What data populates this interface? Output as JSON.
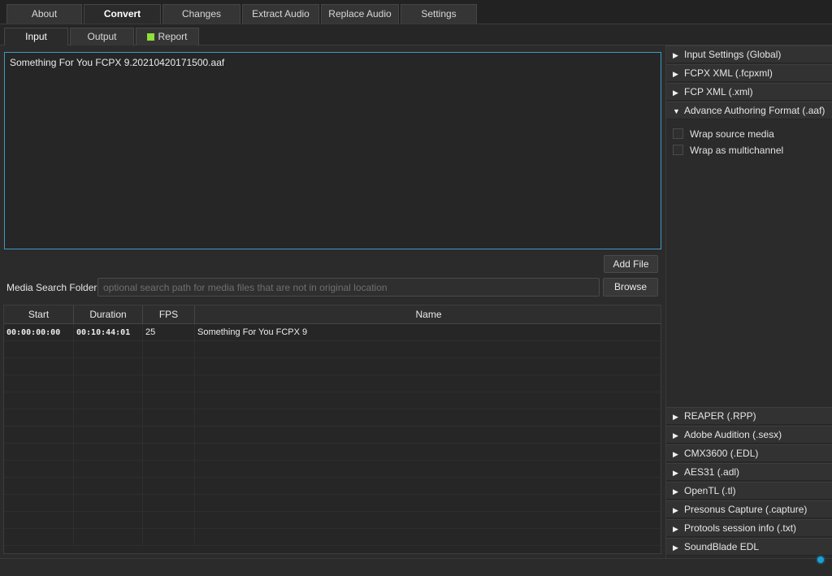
{
  "top_tabs": [
    "About",
    "Convert",
    "Changes",
    "Extract Audio",
    "Replace Audio",
    "Settings"
  ],
  "sub_tabs": [
    "Input",
    "Output",
    "Report"
  ],
  "input_files": [
    "Something For You FCPX 9.20210420171500.aaf"
  ],
  "add_file_label": "Add File",
  "media_search": {
    "label": "Media Search Folder",
    "placeholder": "optional search path for media files that are not in original location",
    "value": "",
    "browse_label": "Browse"
  },
  "table": {
    "headers": [
      "Start",
      "Duration",
      "FPS",
      "Name"
    ],
    "rows": [
      [
        "00:00:00:00",
        "00:10:44:01",
        "25",
        "Something For You FCPX 9"
      ]
    ]
  },
  "right_panel": {
    "sections_top": [
      {
        "label": "Input Settings (Global)",
        "arrow": "▶"
      },
      {
        "label": "FCPX XML (.fcpxml)",
        "arrow": "▶"
      },
      {
        "label": "FCP XML (.xml)",
        "arrow": "▶"
      },
      {
        "label": "Advance Authoring Format (.aaf)",
        "arrow": "▼"
      }
    ],
    "aaf_options": [
      "Wrap source media",
      "Wrap as multichannel"
    ],
    "sections_bottom": [
      {
        "label": "REAPER (.RPP)",
        "arrow": "▶"
      },
      {
        "label": "Adobe Audition (.sesx)",
        "arrow": "▶"
      },
      {
        "label": "CMX3600 (.EDL)",
        "arrow": "▶"
      },
      {
        "label": "AES31 (.adl)",
        "arrow": "▶"
      },
      {
        "label": "OpenTL (.tl)",
        "arrow": "▶"
      },
      {
        "label": "Presonus Capture (.capture)",
        "arrow": "▶"
      },
      {
        "label": "Protools session info (.txt)",
        "arrow": "▶"
      },
      {
        "label": "SoundBlade EDL",
        "arrow": "▶"
      }
    ]
  },
  "colors": {
    "accent_border": "#3e9bc1",
    "report_indicator": "#8ee03a",
    "status_led": "#1aa0d8"
  }
}
